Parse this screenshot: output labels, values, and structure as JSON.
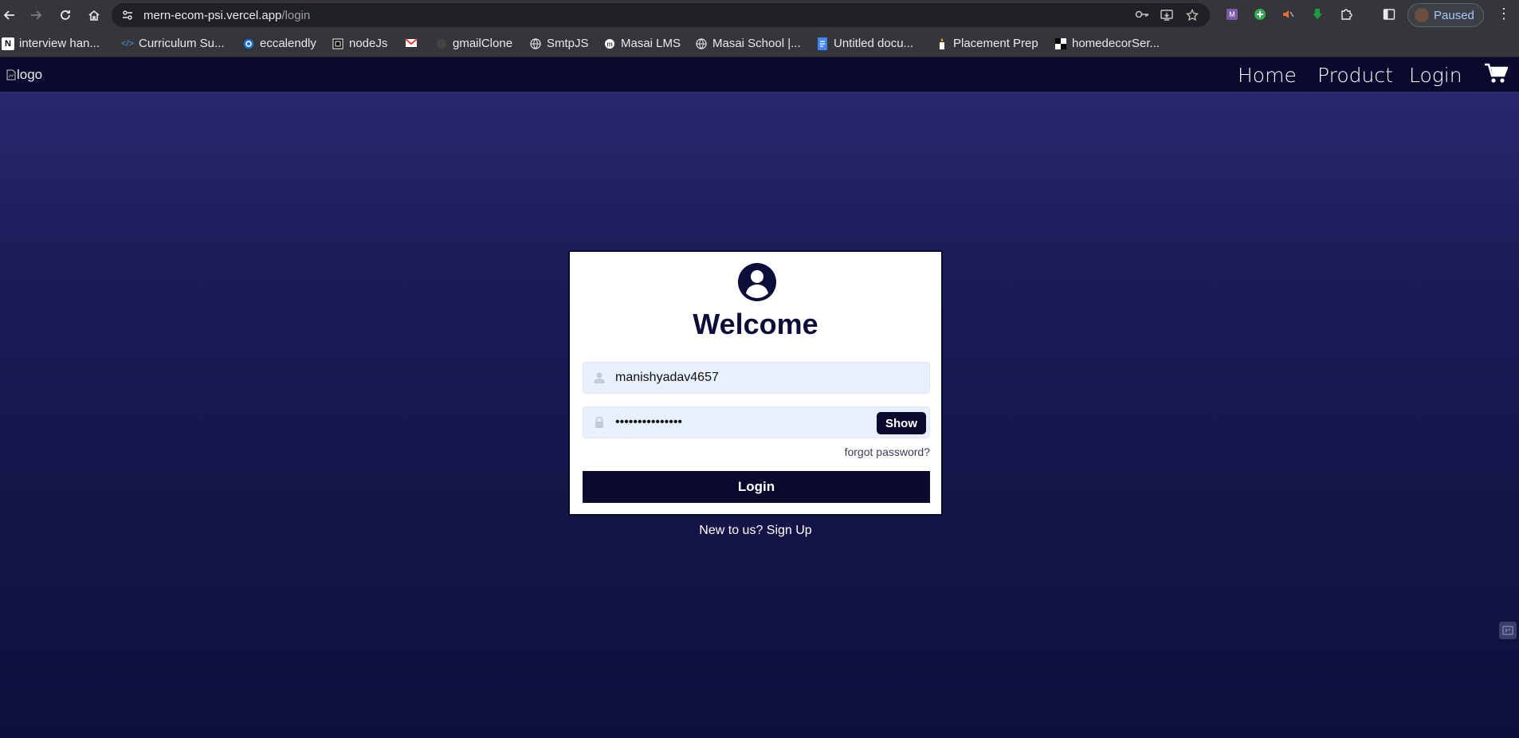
{
  "browser": {
    "url_host": "mern-ecom-psi.vercel.app",
    "url_path": "/login",
    "profile_label": "Paused"
  },
  "bookmarks": [
    {
      "label": "interview han...",
      "icon": "notion-icon"
    },
    {
      "label": "Curriculum Su...",
      "icon": "code-icon"
    },
    {
      "label": "eccalendly",
      "icon": "calendly-icon"
    },
    {
      "label": "nodeJs",
      "icon": "square-icon"
    },
    {
      "label": "",
      "icon": "gmail-icon"
    },
    {
      "label": "gmailClone",
      "icon": "github-icon"
    },
    {
      "label": "SmtpJS",
      "icon": "globe-icon"
    },
    {
      "label": "Masai LMS",
      "icon": "masai-icon"
    },
    {
      "label": "Masai School |...",
      "icon": "globe-icon"
    },
    {
      "label": "Untitled docu...",
      "icon": "docs-icon"
    },
    {
      "label": "Placement Prep",
      "icon": "candle-icon"
    },
    {
      "label": "homedecorSer...",
      "icon": "checker-icon"
    }
  ],
  "site_nav": {
    "logo_alt": "logo",
    "links": [
      "Home",
      "Product",
      "Login"
    ]
  },
  "login_card": {
    "title": "Welcome",
    "username_value": "manishyadav4657",
    "password_value": "•••••••••••••••",
    "show_label": "Show",
    "forgot_label": "forgot password?",
    "login_label": "Login",
    "signup_label": "New to us? Sign Up"
  },
  "colors": {
    "nav_bg": "#0a0a2e",
    "page_gradient_top": "#2a2a72",
    "page_gradient_bottom": "#0f0f3d",
    "input_bg": "#e8effd",
    "button_bg": "#0a0a2e"
  }
}
